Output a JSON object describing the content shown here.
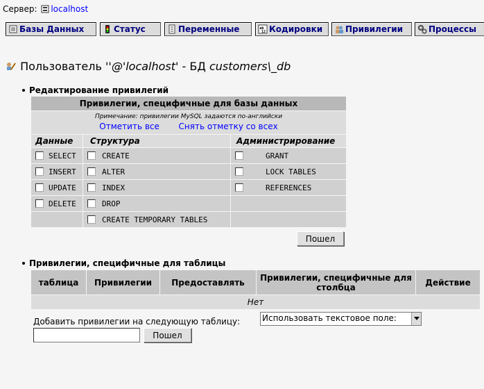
{
  "server": {
    "label": "Сервер:",
    "host": "localhost"
  },
  "tabs": [
    {
      "label": "Базы Данных"
    },
    {
      "label": "Статус"
    },
    {
      "label": "Переменные"
    },
    {
      "label": "Кодировки"
    },
    {
      "label": "Привилегии"
    },
    {
      "label": "Процессы"
    }
  ],
  "title": {
    "prefix": "Пользователь ",
    "user": "''@'localhost'",
    "mid": " - БД ",
    "db": "customers\\_db"
  },
  "section1": {
    "heading": "Редактирование привилегий",
    "table_title": "Привилегии, специфичные для базы данных",
    "note": "Примечание: привилегии MySQL задаются по-английски",
    "check_all": "Отметить все",
    "uncheck_all": "Снять отметку со всех",
    "col_data": "Данные",
    "col_structure": "Структура",
    "col_admin": "Администрирование",
    "data_items": [
      "SELECT",
      "INSERT",
      "UPDATE",
      "DELETE"
    ],
    "structure_items": [
      "CREATE",
      "ALTER",
      "INDEX",
      "DROP",
      "CREATE TEMPORARY TABLES"
    ],
    "admin_items": [
      "GRANT",
      "LOCK TABLES",
      "REFERENCES"
    ],
    "go_button": "Пошел"
  },
  "section2": {
    "heading": "Привилегии, специфичные для таблицы",
    "columns": [
      "таблица",
      "Привилегии",
      "Предоставлять",
      "Привилегии, специфичные для столбца",
      "Действие"
    ],
    "empty": "Нет",
    "add_label": "Добавить привилегии на следующую таблицу:",
    "select_value": "Использовать текстовое поле:",
    "input_value": "",
    "go_button": "Пошел"
  }
}
